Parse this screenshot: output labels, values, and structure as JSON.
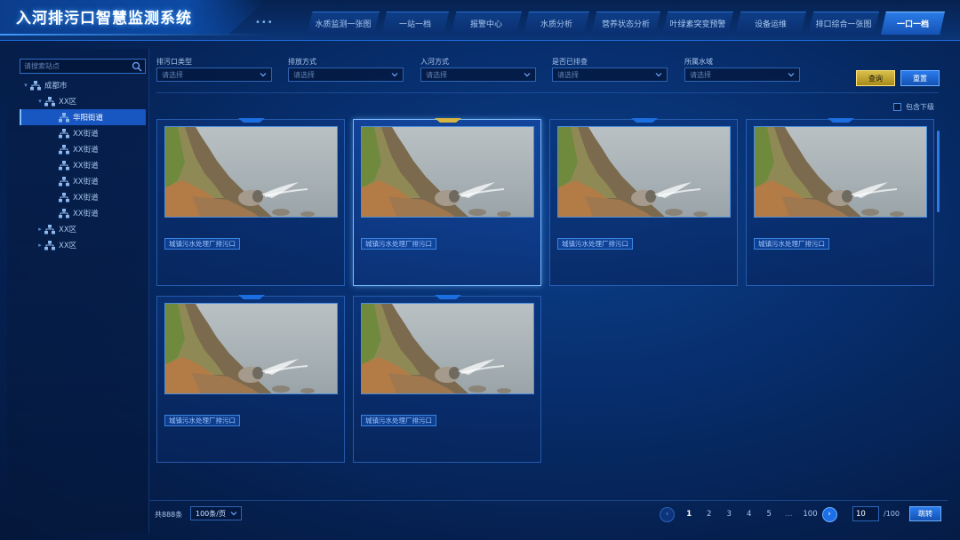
{
  "header": {
    "title": "入河排污口智慧监测系统",
    "dots": "•••",
    "tabs": [
      {
        "label": "水质监测一张图",
        "active": false
      },
      {
        "label": "一站一档",
        "active": false
      },
      {
        "label": "报警中心",
        "active": false
      },
      {
        "label": "水质分析",
        "active": false
      },
      {
        "label": "营养状态分析",
        "active": false
      },
      {
        "label": "叶绿素突变预警",
        "active": false
      },
      {
        "label": "设备运维",
        "active": false
      },
      {
        "label": "排口综合一张图",
        "active": false
      },
      {
        "label": "一口一档",
        "active": true
      }
    ]
  },
  "sidebar": {
    "search_placeholder": "请搜索站点",
    "tree": [
      {
        "label": "成都市",
        "level": 0,
        "caret": "▾",
        "selected": false
      },
      {
        "label": "XX区",
        "level": 1,
        "caret": "▾",
        "selected": false
      },
      {
        "label": "华阳街道",
        "level": 2,
        "caret": "",
        "selected": true
      },
      {
        "label": "XX街道",
        "level": 2,
        "caret": "",
        "selected": false
      },
      {
        "label": "XX街道",
        "level": 2,
        "caret": "",
        "selected": false
      },
      {
        "label": "XX街道",
        "level": 2,
        "caret": "",
        "selected": false
      },
      {
        "label": "XX街道",
        "level": 2,
        "caret": "",
        "selected": false
      },
      {
        "label": "XX街道",
        "level": 2,
        "caret": "",
        "selected": false
      },
      {
        "label": "XX街道",
        "level": 2,
        "caret": "",
        "selected": false
      },
      {
        "label": "XX区",
        "level": 1,
        "caret": "▸",
        "selected": false
      },
      {
        "label": "XX区",
        "level": 1,
        "caret": "▸",
        "selected": false
      }
    ]
  },
  "filters": [
    {
      "label": "排污口类型",
      "placeholder": "请选择"
    },
    {
      "label": "排放方式",
      "placeholder": "请选择"
    },
    {
      "label": "入河方式",
      "placeholder": "请选择"
    },
    {
      "label": "是否已排查",
      "placeholder": "请选择"
    },
    {
      "label": "所属水域",
      "placeholder": "请选择"
    }
  ],
  "actions": {
    "query": "查询",
    "reset": "重置",
    "include_sub": "包含下级"
  },
  "cards": [
    {
      "label": "城镇污水处理厂排污口",
      "highlight": false
    },
    {
      "label": "城镇污水处理厂排污口",
      "highlight": true
    },
    {
      "label": "城镇污水处理厂排污口",
      "highlight": false
    },
    {
      "label": "城镇污水处理厂排污口",
      "highlight": false
    },
    {
      "label": "城镇污水处理厂排污口",
      "highlight": false
    },
    {
      "label": "城镇污水处理厂排污口",
      "highlight": false
    }
  ],
  "pagination": {
    "total": "共888条",
    "page_size": "100条/页",
    "pages": [
      "1",
      "2",
      "3",
      "4",
      "5"
    ],
    "current": "1",
    "ellipsis": "...",
    "last": "100",
    "goto_value": "10",
    "goto_total": "/100",
    "goto_label": "跳转"
  },
  "colors": {
    "accent": "#1c6fe8",
    "query_button": "#d8c04a",
    "background": "#072d6b"
  }
}
